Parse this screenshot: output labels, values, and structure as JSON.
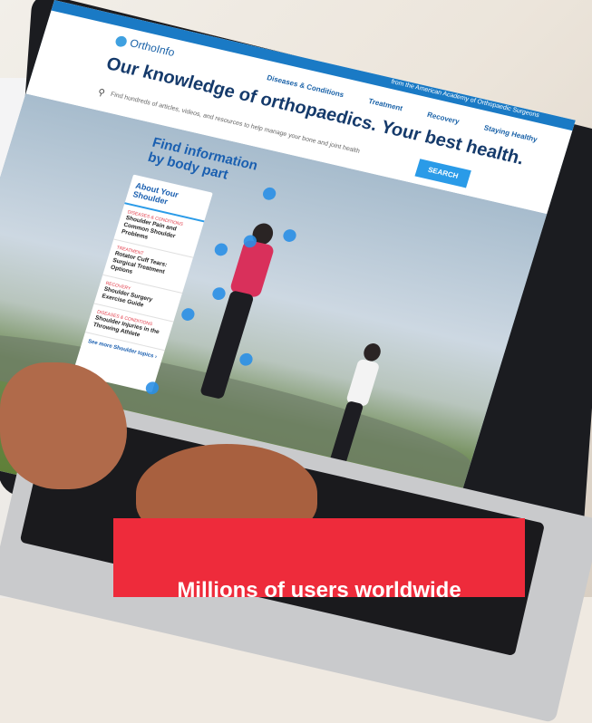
{
  "site": {
    "logo_text": "OrthoInfo",
    "topbar_text": "from the American Academy of Orthopaedic Surgeons",
    "nav": [
      "Diseases & Conditions",
      "Treatment",
      "Recovery",
      "Staying Healthy"
    ],
    "tagline": "Our knowledge of orthopaedics. Your best health.",
    "search_placeholder": "Find hundreds of articles, videos, and resources to help manage your bone and joint health",
    "search_button": "SEARCH"
  },
  "body_part": {
    "heading_line1": "Find information",
    "heading_line2": "by body part"
  },
  "card": {
    "title": "About Your Shoulder",
    "items": [
      {
        "category": "DISEASES & CONDITIONS",
        "title": "Shoulder Pain and Common Shoulder Problems"
      },
      {
        "category": "TREATMENT",
        "title": "Rotator Cuff Tears: Surgical Treatment Options"
      },
      {
        "category": "RECOVERY",
        "title": "Shoulder Surgery Exercise Guide"
      },
      {
        "category": "DISEASES & CONDITIONS",
        "title": "Shoulder Injuries in the Throwing Athlete"
      }
    ],
    "more_link": "See more Shoulder topics ›"
  },
  "banner": {
    "text": "Millions of users worldwide"
  },
  "colors": {
    "banner": "#ee2b3b",
    "accent": "#2a9be8",
    "navy": "#153a6b"
  }
}
